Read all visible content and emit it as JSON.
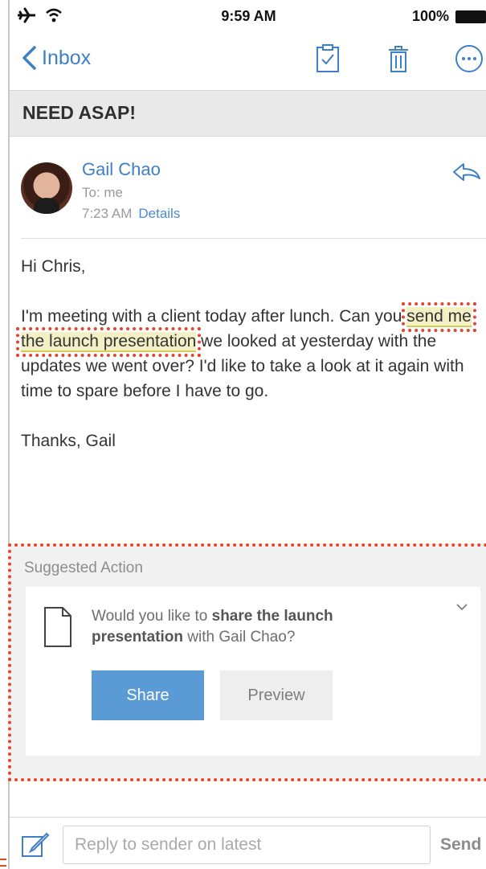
{
  "status_bar": {
    "time": "9:59 AM",
    "battery": "100%",
    "icons": [
      "airplane-icon",
      "wifi-icon",
      "battery-icon"
    ]
  },
  "nav": {
    "back_label": "Inbox",
    "icons": [
      "clipboard-check-icon",
      "trash-icon",
      "more-icon"
    ],
    "accent_color": "#3f7fc7"
  },
  "email": {
    "subject": "NEED ASAP!",
    "sender_name": "Gail Chao",
    "to": "To: me",
    "time": "7:23 AM",
    "details_label": "Details",
    "greeting": "Hi Chris,",
    "para1_before": "I'm meeting with a client today after lunch. Can you ",
    "para1_highlight": "send me the launch presentation",
    "para1_after": " we looked at yesterday with the updates we went over? I'd like to take a look at it again with time to spare before I have to go.",
    "signoff": "Thanks, Gail"
  },
  "suggested_action": {
    "label": "Suggested Action",
    "text_before": "Would you like to ",
    "text_bold": "share the launch presentation",
    "text_after": " with Gail Chao?",
    "share_label": "Share",
    "preview_label": "Preview",
    "share_color": "#5b9bd5"
  },
  "reply_bar": {
    "placeholder": "Reply to sender on latest",
    "send_label": "Send"
  },
  "annotation_color": "#e1472f"
}
